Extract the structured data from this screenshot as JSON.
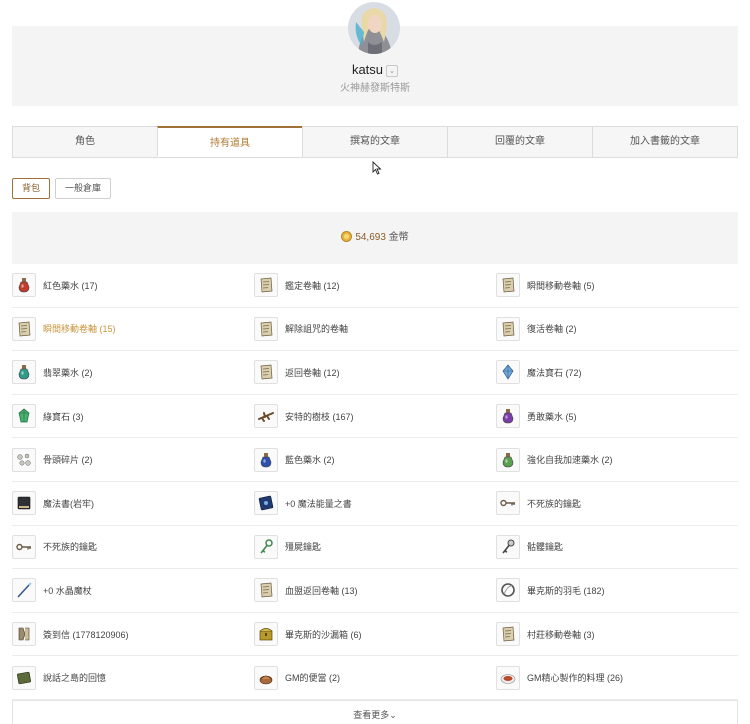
{
  "profile": {
    "username": "katsu",
    "server": "火神赫發斯特斯"
  },
  "tabs": [
    "角色",
    "持有道具",
    "撰寫的文章",
    "回覆的文章",
    "加入書籤的文章"
  ],
  "active_tab_index": 1,
  "subtabs": [
    "背包",
    "一般倉庫"
  ],
  "active_subtab_index": 0,
  "gold": {
    "amount": "54,693",
    "unit": "金幣"
  },
  "items": [
    [
      {
        "name": "紅色藥水 (17)",
        "icon": "red-potion-icon"
      },
      {
        "name": "鑑定卷軸 (12)",
        "icon": "scroll-icon"
      },
      {
        "name": "瞬間移動卷軸 (5)",
        "icon": "scroll-icon"
      }
    ],
    [
      {
        "name": "瞬間移動卷軸 (15)",
        "icon": "scroll-icon",
        "highlight": true
      },
      {
        "name": "解除詛咒的卷軸",
        "icon": "scroll-icon"
      },
      {
        "name": "復活卷軸 (2)",
        "icon": "scroll-icon"
      }
    ],
    [
      {
        "name": "翡翠藥水 (2)",
        "icon": "green-potion-icon"
      },
      {
        "name": "返回卷軸 (12)",
        "icon": "scroll-icon"
      },
      {
        "name": "魔法寶石 (72)",
        "icon": "magic-gem-icon"
      }
    ],
    [
      {
        "name": "綠寶石 (3)",
        "icon": "emerald-icon"
      },
      {
        "name": "安特的樹枝 (167)",
        "icon": "branch-icon"
      },
      {
        "name": "勇敢藥水 (5)",
        "icon": "purple-potion-icon"
      }
    ],
    [
      {
        "name": "骨頭碎片 (2)",
        "icon": "bone-fragment-icon"
      },
      {
        "name": "藍色藥水 (2)",
        "icon": "blue-potion-icon"
      },
      {
        "name": "強化自我加速藥水 (2)",
        "icon": "haste-potion-icon"
      }
    ],
    [
      {
        "name": "魔法書(岩牢)",
        "icon": "spellbook-icon"
      },
      {
        "name": "+0 魔法能量之書",
        "icon": "blue-book-icon"
      },
      {
        "name": "不死族的鑰匙",
        "icon": "key-icon"
      }
    ],
    [
      {
        "name": "不死族的鑰匙",
        "icon": "key-icon"
      },
      {
        "name": "殭屍鑰匙",
        "icon": "zombie-key-icon"
      },
      {
        "name": "骷髏鑰匙",
        "icon": "skeleton-key-icon"
      }
    ],
    [
      {
        "name": "+0 水晶魔杖",
        "icon": "crystal-wand-icon"
      },
      {
        "name": "血盟返回卷軸 (13)",
        "icon": "scroll-icon"
      },
      {
        "name": "畢克斯的羽毛 (182)",
        "icon": "feather-ring-icon"
      }
    ],
    [
      {
        "name": "簽到信 (1778120906)",
        "icon": "letter-icon"
      },
      {
        "name": "畢克斯的沙漏箱 (6)",
        "icon": "treasure-chest-icon"
      },
      {
        "name": "村莊移動卷軸 (3)",
        "icon": "scroll-icon"
      }
    ],
    [
      {
        "name": "說話之島的回憶",
        "icon": "memory-book-icon"
      },
      {
        "name": "GM的便當 (2)",
        "icon": "lunchbox-icon"
      },
      {
        "name": "GM精心製作的料理 (26)",
        "icon": "food-dish-icon"
      }
    ]
  ],
  "more_label": "查看更多"
}
